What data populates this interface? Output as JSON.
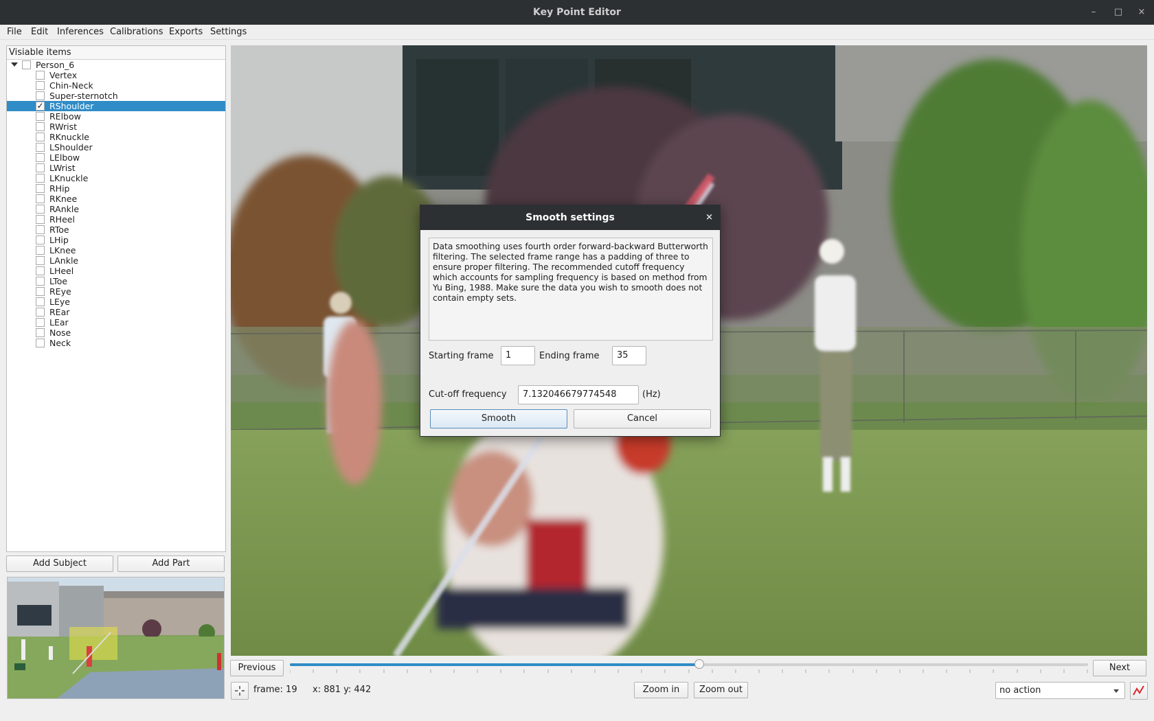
{
  "window": {
    "title": "Key Point Editor"
  },
  "menu": [
    "File",
    "Edit",
    "Inferences",
    "Calibrations",
    "Exports",
    "Settings"
  ],
  "tree": {
    "header": "Visiable items",
    "subject": "Person_6",
    "items": [
      {
        "label": "Vertex",
        "checked": false
      },
      {
        "label": "Chin-Neck",
        "checked": false
      },
      {
        "label": "Super-sternotch",
        "checked": false
      },
      {
        "label": "RShoulder",
        "checked": true,
        "selected": true
      },
      {
        "label": "RElbow",
        "checked": false
      },
      {
        "label": "RWrist",
        "checked": false
      },
      {
        "label": "RKnuckle",
        "checked": false
      },
      {
        "label": "LShoulder",
        "checked": false
      },
      {
        "label": "LElbow",
        "checked": false
      },
      {
        "label": "LWrist",
        "checked": false
      },
      {
        "label": "LKnuckle",
        "checked": false
      },
      {
        "label": "RHip",
        "checked": false
      },
      {
        "label": "RKnee",
        "checked": false
      },
      {
        "label": "RAnkle",
        "checked": false
      },
      {
        "label": "RHeel",
        "checked": false
      },
      {
        "label": "RToe",
        "checked": false
      },
      {
        "label": "LHip",
        "checked": false
      },
      {
        "label": "LKnee",
        "checked": false
      },
      {
        "label": "LAnkle",
        "checked": false
      },
      {
        "label": "LHeel",
        "checked": false
      },
      {
        "label": "LToe",
        "checked": false
      },
      {
        "label": "REye",
        "checked": false
      },
      {
        "label": "LEye",
        "checked": false
      },
      {
        "label": "REar",
        "checked": false
      },
      {
        "label": "LEar",
        "checked": false
      },
      {
        "label": "Nose",
        "checked": false
      },
      {
        "label": "Neck",
        "checked": false
      }
    ]
  },
  "buttons": {
    "add_subject": "Add Subject",
    "add_part": "Add Part",
    "previous": "Previous",
    "next": "Next",
    "zoom_in": "Zoom in",
    "zoom_out": "Zoom out"
  },
  "timeline": {
    "position_fraction": 0.513
  },
  "status": {
    "frame": "frame: 19",
    "coords": "x: 881 y: 442"
  },
  "action_select": {
    "value": "no action"
  },
  "dialog": {
    "title": "Smooth settings",
    "close": "×",
    "text": "Data smoothing uses fourth order forward-backward Butterworth filtering. The selected frame range has a padding of three to ensure proper filtering. The recommended cutoff frequency which accounts for sampling frequency is based on method from Yu Bing, 1988. Make sure the data you wish to smooth does not contain empty sets.",
    "starting_frame_label": "Starting frame",
    "starting_frame_value": "1",
    "ending_frame_label": "Ending frame",
    "ending_frame_value": "35",
    "cutoff_label": "Cut-off frequency",
    "cutoff_value": "7.132046679774548",
    "cutoff_unit": "(Hz)",
    "smooth_button": "Smooth",
    "cancel_button": "Cancel"
  },
  "window_controls": {
    "minimize": "–",
    "maximize": "□",
    "close": "×"
  },
  "icons": {
    "crosshair": "crosshair-icon",
    "chart": "chart-icon"
  },
  "colors": {
    "selection": "#308cc6",
    "titlebar": "#2d3033",
    "chart_icon": "#d9262b"
  }
}
